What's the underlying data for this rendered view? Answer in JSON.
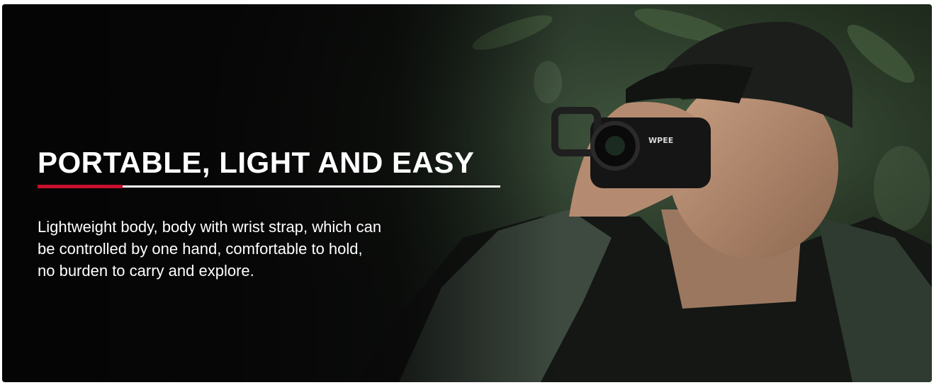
{
  "banner": {
    "title": "PORTABLE, LIGHT AND EASY",
    "description_lines": [
      "Lightweight body, body with wrist strap, which can",
      "be controlled by one hand, comfortable to hold,",
      "no burden to carry and explore."
    ],
    "device_brand": "WPEE",
    "accent_color": "#c8102e",
    "text_color": "#ffffff"
  }
}
